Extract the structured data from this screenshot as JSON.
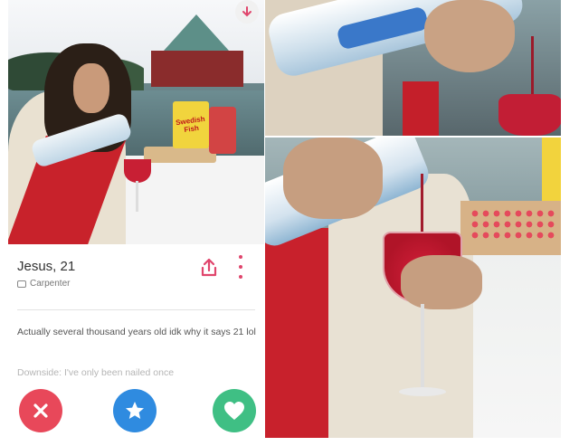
{
  "profile": {
    "name_age": "Jesus, 21",
    "job": "Carpenter",
    "bio": "Actually several thousand years old idk why it says 21 lol",
    "downside": "Downside: I've only been nailed once",
    "candy_bag_text": "Swedish Fish"
  },
  "icons": {
    "share": "share-icon",
    "more": "more-vertical-icon",
    "nope": "close-icon",
    "super_like": "star-icon",
    "like": "heart-icon",
    "job": "briefcase-icon",
    "badge": "arrow-down-icon"
  },
  "colors": {
    "nope": "#e8485a",
    "super_like": "#2f8be0",
    "like": "#3fbf84",
    "accent": "#e0456c"
  }
}
